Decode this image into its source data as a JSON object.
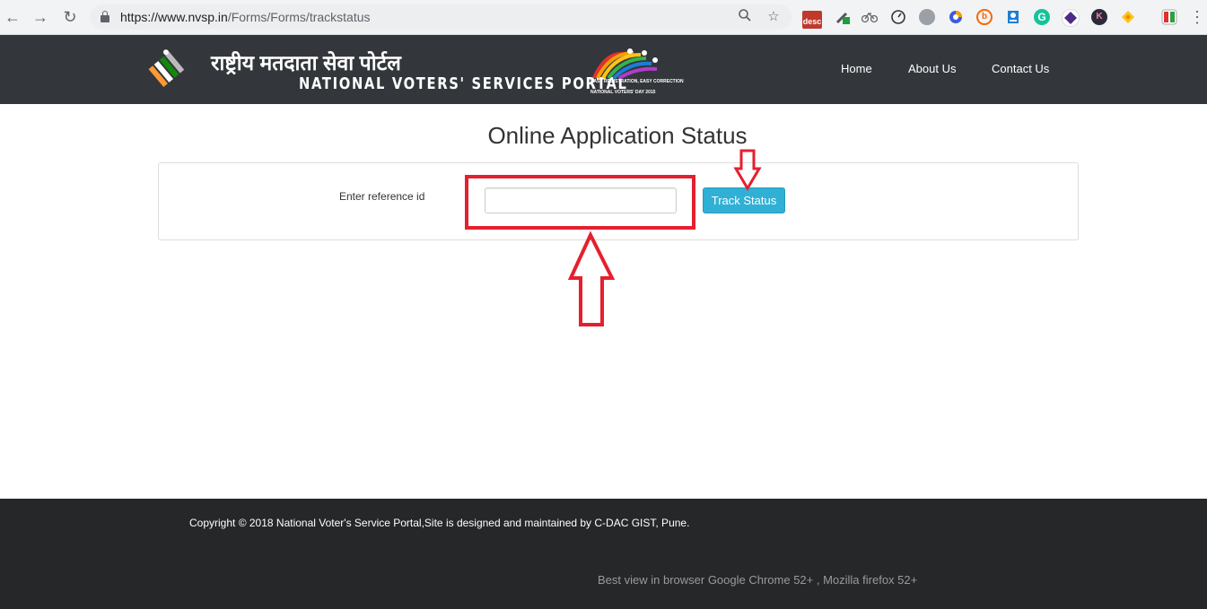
{
  "browser": {
    "url_host": "https://www.nvsp.in",
    "url_path": "/Forms/Forms/trackstatus",
    "extensions": [
      "desc-icon",
      "extension-green-icon",
      "extension-bike-icon",
      "speed-icon",
      "globe-icon",
      "extension-dots-icon",
      "extension-b-icon",
      "extension-a-icon",
      "grammarly-icon",
      "extension-diamond-icon",
      "extension-k-icon",
      "extension-yellow-icon",
      "extension-vb-icon"
    ],
    "desc_label": "desc",
    "k_label": "K"
  },
  "header": {
    "title_hindi": "राष्ट्रीय मतदाता सेवा पोर्टल",
    "title_english": "NATIONAL VOTERS' SERVICES PORTAL",
    "nvd_line1": "EASY REGISTRATION, EASY CORRECTION",
    "nvd_line2": "NATIONAL VOTERS' DAY 2015",
    "nav": {
      "home": "Home",
      "about": "About Us",
      "contact": "Contact Us"
    }
  },
  "main": {
    "title": "Online Application Status",
    "ref_label": "Enter reference id",
    "ref_value": "",
    "ref_placeholder": "",
    "track_button": "Track Status"
  },
  "footer": {
    "copyright": "Copyright © 2018 National Voter's Service Portal,Site is designed and maintained by C-DAC GIST, Pune.",
    "best_view": "Best view in browser Google Chrome 52+ , Mozilla firefox 52+"
  },
  "colors": {
    "header_bg": "#33373b",
    "footer_bg": "#252729",
    "button_bg": "#31b0d5",
    "annotation": "#e5202e"
  }
}
